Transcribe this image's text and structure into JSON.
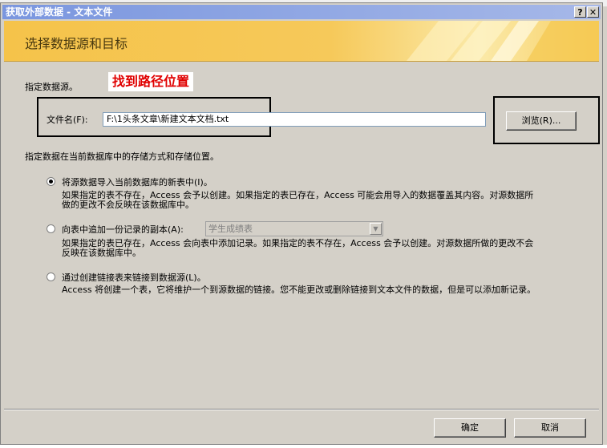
{
  "window": {
    "title": "获取外部数据 - 文本文件",
    "help_glyph": "?",
    "close_glyph": "✕"
  },
  "banner": {
    "title": "选择数据源和目标"
  },
  "source": {
    "heading": "指定数据源。",
    "annotation": "找到路径位置",
    "filename_label": "文件名(F):",
    "filename_value": "F:\\1头条文章\\新建文本文档.txt",
    "browse_label": "浏览(R)..."
  },
  "storage": {
    "heading": "指定数据在当前数据库中的存储方式和存储位置。",
    "options": [
      {
        "label": "将源数据导入当前数据库的新表中(I)。",
        "desc1": "如果指定的表不存在，Access 会予以创建。如果指定的表已存在，Access 可能会用导入的数据覆盖其内容。对源数据所",
        "desc2": "做的更改不会反映在该数据库中。",
        "selected": true
      },
      {
        "label": "向表中追加一份记录的副本(A):",
        "combo_value": "学生成绩表",
        "desc1": "如果指定的表已存在，Access 会向表中添加记录。如果指定的表不存在，Access 会予以创建。对源数据所做的更改不会",
        "desc2": "反映在该数据库中。",
        "selected": false
      },
      {
        "label": "通过创建链接表来链接到数据源(L)。",
        "desc1": "Access 将创建一个表，它将维护一个到源数据的链接。您不能更改或删除链接到文本文件的数据，但是可以添加新记录。",
        "selected": false
      }
    ]
  },
  "footer": {
    "ok_label": "确定",
    "cancel_label": "取消"
  }
}
